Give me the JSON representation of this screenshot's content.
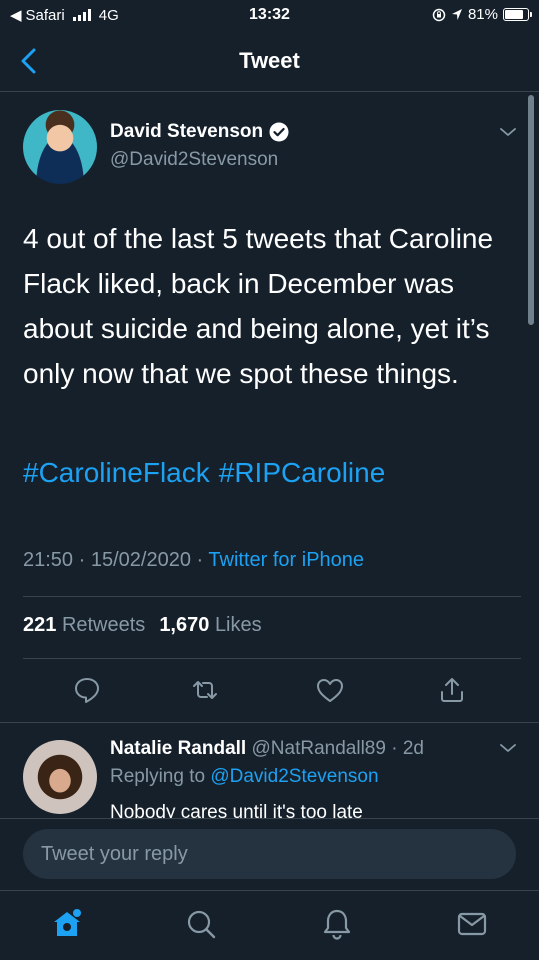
{
  "status_bar": {
    "back_app": "Safari",
    "network": "4G",
    "time": "13:32",
    "battery": "81%",
    "battery_level": 0.81
  },
  "nav": {
    "title": "Tweet"
  },
  "tweet": {
    "author_name": "David Stevenson",
    "author_handle": "@David2Stevenson",
    "text": "4 out of the last 5 tweets that Caroline Flack liked, back in December was about suicide and being alone, yet it’s only now that we spot these things.",
    "hashtags": [
      "#CarolineFlack",
      "#RIPCaroline"
    ],
    "time": "21:50",
    "date": "15/02/2020",
    "source": "Twitter for iPhone",
    "retweets_count": "221",
    "retweets_label": "Retweets",
    "likes_count": "1,670",
    "likes_label": "Likes"
  },
  "reply": {
    "name": "Natalie Randall",
    "handle": "@NatRandall89",
    "age": "2d",
    "replying_label": "Replying to",
    "replying_to": "@David2Stevenson",
    "text": "Nobody cares until it's too late"
  },
  "composer": {
    "placeholder": "Tweet your reply"
  },
  "colors": {
    "background": "#15202b",
    "accent": "#1da1f2",
    "muted": "#8899a6",
    "divider": "#38444d"
  },
  "icons": {
    "actions": [
      "reply-icon",
      "retweet-icon",
      "like-icon",
      "share-icon"
    ],
    "tabs": [
      "home-icon",
      "search-icon",
      "notifications-icon",
      "messages-icon"
    ]
  }
}
